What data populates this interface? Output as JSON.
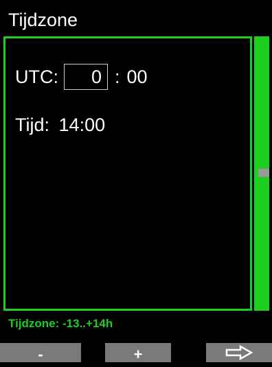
{
  "title": "Tijdzone",
  "utc": {
    "label": "UTC:",
    "hours": "0",
    "separator": ":",
    "minutes": "00"
  },
  "tijd": {
    "label": "Tijd:",
    "value": "14:00"
  },
  "range_text": "Tijdzone: -13..+14h",
  "softkeys": {
    "minus": "-",
    "plus": "+",
    "next_icon": "arrow-right-outline-icon"
  },
  "colors": {
    "accent": "#1fcf1f",
    "background": "#000000",
    "softkey": "#7a7a7a"
  }
}
